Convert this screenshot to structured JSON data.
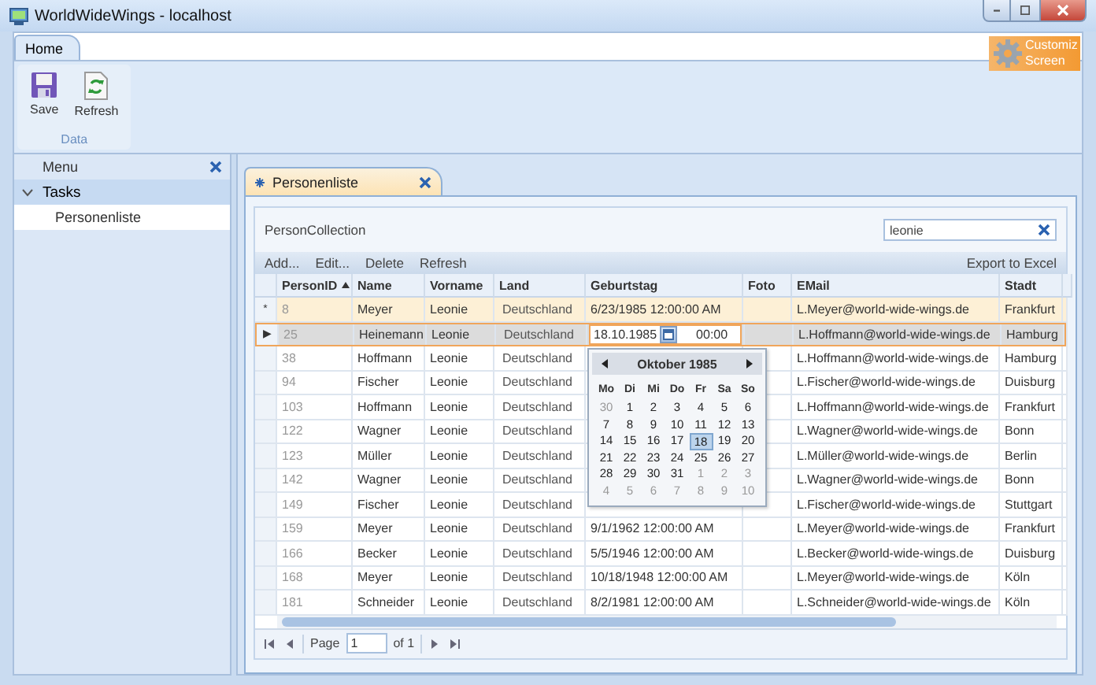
{
  "window": {
    "title": "WorldWideWings - localhost"
  },
  "ribbon": {
    "tabs": [
      {
        "label": "Home",
        "selected": true
      }
    ],
    "groups": [
      {
        "label": "Data",
        "buttons": [
          {
            "label": "Save",
            "kind": "save"
          },
          {
            "label": "Refresh",
            "kind": "refresh"
          }
        ]
      }
    ],
    "customize": {
      "label_lines": [
        "Customiz",
        "Screen"
      ]
    }
  },
  "menu": {
    "title": "Menu",
    "groups": [
      {
        "label": "Tasks",
        "expanded": true,
        "items": [
          {
            "label": "Personenliste",
            "selected": true
          }
        ]
      }
    ]
  },
  "documents": {
    "tabs": [
      {
        "label": "Personenliste",
        "selected": true
      }
    ]
  },
  "screen": {
    "collection_title": "PersonCollection",
    "search": {
      "value": "leonie"
    },
    "commands": [
      "Add...",
      "Edit...",
      "Delete",
      "Refresh"
    ],
    "export": "Export to Excel",
    "grid": {
      "columns": [
        {
          "label": "PersonID",
          "sort_ascending": true
        },
        {
          "label": "Name"
        },
        {
          "label": "Vorname"
        },
        {
          "label": "Land"
        },
        {
          "label": "Geburtstag"
        },
        {
          "label": "Foto"
        },
        {
          "label": "EMail"
        },
        {
          "label": "Stadt"
        }
      ],
      "rows": [
        {
          "indicator": "*",
          "highlighted": true,
          "selected": false,
          "id": "8",
          "name": "Meyer",
          "vorname": "Leonie",
          "land": "Deutschland",
          "geburtstag": "6/23/1985 12:00:00 AM",
          "email": "L.Meyer@world-wide-wings.de",
          "stadt": "Frankfurt"
        },
        {
          "indicator": "▶",
          "highlighted": false,
          "selected": true,
          "id": "25",
          "name": "Heinemann",
          "vorname": "Leonie",
          "land": "Deutschland",
          "email": "L.Hoffmann@world-wide-wings.de",
          "stadt": "Hamburg",
          "editor": {
            "date": "18.10.1985",
            "time": "00:00",
            "calendar": {
              "month": "Oktober 1985",
              "weekdays": [
                "Mo",
                "Di",
                "Mi",
                "Do",
                "Fr",
                "Sa",
                "So"
              ],
              "weeks": [
                [
                  {
                    "day": "30",
                    "outside": true,
                    "selected": false
                  },
                  {
                    "day": "1",
                    "outside": false,
                    "selected": false
                  },
                  {
                    "day": "2",
                    "outside": false,
                    "selected": false
                  },
                  {
                    "day": "3",
                    "outside": false,
                    "selected": false
                  },
                  {
                    "day": "4",
                    "outside": false,
                    "selected": false
                  },
                  {
                    "day": "5",
                    "outside": false,
                    "selected": false
                  },
                  {
                    "day": "6",
                    "outside": false,
                    "selected": false
                  }
                ],
                [
                  {
                    "day": "7",
                    "outside": false,
                    "selected": false
                  },
                  {
                    "day": "8",
                    "outside": false,
                    "selected": false
                  },
                  {
                    "day": "9",
                    "outside": false,
                    "selected": false
                  },
                  {
                    "day": "10",
                    "outside": false,
                    "selected": false
                  },
                  {
                    "day": "11",
                    "outside": false,
                    "selected": false
                  },
                  {
                    "day": "12",
                    "outside": false,
                    "selected": false
                  },
                  {
                    "day": "13",
                    "outside": false,
                    "selected": false
                  }
                ],
                [
                  {
                    "day": "14",
                    "outside": false,
                    "selected": false
                  },
                  {
                    "day": "15",
                    "outside": false,
                    "selected": false
                  },
                  {
                    "day": "16",
                    "outside": false,
                    "selected": false
                  },
                  {
                    "day": "17",
                    "outside": false,
                    "selected": false
                  },
                  {
                    "day": "18",
                    "outside": false,
                    "selected": true
                  },
                  {
                    "day": "19",
                    "outside": false,
                    "selected": false
                  },
                  {
                    "day": "20",
                    "outside": false,
                    "selected": false
                  }
                ],
                [
                  {
                    "day": "21",
                    "outside": false,
                    "selected": false
                  },
                  {
                    "day": "22",
                    "outside": false,
                    "selected": false
                  },
                  {
                    "day": "23",
                    "outside": false,
                    "selected": false
                  },
                  {
                    "day": "24",
                    "outside": false,
                    "selected": false
                  },
                  {
                    "day": "25",
                    "outside": false,
                    "selected": false
                  },
                  {
                    "day": "26",
                    "outside": false,
                    "selected": false
                  },
                  {
                    "day": "27",
                    "outside": false,
                    "selected": false
                  }
                ],
                [
                  {
                    "day": "28",
                    "outside": false,
                    "selected": false
                  },
                  {
                    "day": "29",
                    "outside": false,
                    "selected": false
                  },
                  {
                    "day": "30",
                    "outside": false,
                    "selected": false
                  },
                  {
                    "day": "31",
                    "outside": false,
                    "selected": false
                  },
                  {
                    "day": "1",
                    "outside": true,
                    "selected": false
                  },
                  {
                    "day": "2",
                    "outside": true,
                    "selected": false
                  },
                  {
                    "day": "3",
                    "outside": true,
                    "selected": false
                  }
                ],
                [
                  {
                    "day": "4",
                    "outside": true,
                    "selected": false
                  },
                  {
                    "day": "5",
                    "outside": true,
                    "selected": false
                  },
                  {
                    "day": "6",
                    "outside": true,
                    "selected": false
                  },
                  {
                    "day": "7",
                    "outside": true,
                    "selected": false
                  },
                  {
                    "day": "8",
                    "outside": true,
                    "selected": false
                  },
                  {
                    "day": "9",
                    "outside": true,
                    "selected": false
                  },
                  {
                    "day": "10",
                    "outside": true,
                    "selected": false
                  }
                ]
              ]
            }
          }
        },
        {
          "highlighted": false,
          "selected": false,
          "id": "38",
          "name": "Hoffmann",
          "vorname": "Leonie",
          "land": "Deutschland",
          "email": "L.Hoffmann@world-wide-wings.de",
          "stadt": "Hamburg"
        },
        {
          "highlighted": false,
          "selected": false,
          "id": "94",
          "name": "Fischer",
          "vorname": "Leonie",
          "land": "Deutschland",
          "email": "L.Fischer@world-wide-wings.de",
          "stadt": "Duisburg"
        },
        {
          "highlighted": false,
          "selected": false,
          "id": "103",
          "name": "Hoffmann",
          "vorname": "Leonie",
          "land": "Deutschland",
          "email": "L.Hoffmann@world-wide-wings.de",
          "stadt": "Frankfurt"
        },
        {
          "highlighted": false,
          "selected": false,
          "id": "122",
          "name": "Wagner",
          "vorname": "Leonie",
          "land": "Deutschland",
          "email": "L.Wagner@world-wide-wings.de",
          "stadt": "Bonn"
        },
        {
          "highlighted": false,
          "selected": false,
          "id": "123",
          "name": "Müller",
          "vorname": "Leonie",
          "land": "Deutschland",
          "email": "L.Müller@world-wide-wings.de",
          "stadt": "Berlin"
        },
        {
          "highlighted": false,
          "selected": false,
          "id": "142",
          "name": "Wagner",
          "vorname": "Leonie",
          "land": "Deutschland",
          "email": "L.Wagner@world-wide-wings.de",
          "stadt": "Bonn"
        },
        {
          "highlighted": false,
          "selected": false,
          "id": "149",
          "name": "Fischer",
          "vorname": "Leonie",
          "land": "Deutschland",
          "email": "L.Fischer@world-wide-wings.de",
          "stadt": "Stuttgart"
        },
        {
          "highlighted": false,
          "selected": false,
          "id": "159",
          "name": "Meyer",
          "vorname": "Leonie",
          "land": "Deutschland",
          "geburtstag": "9/1/1962 12:00:00 AM",
          "email": "L.Meyer@world-wide-wings.de",
          "stadt": "Frankfurt"
        },
        {
          "highlighted": false,
          "selected": false,
          "id": "166",
          "name": "Becker",
          "vorname": "Leonie",
          "land": "Deutschland",
          "geburtstag": "5/5/1946 12:00:00 AM",
          "email": "L.Becker@world-wide-wings.de",
          "stadt": "Duisburg"
        },
        {
          "highlighted": false,
          "selected": false,
          "id": "168",
          "name": "Meyer",
          "vorname": "Leonie",
          "land": "Deutschland",
          "geburtstag": "10/18/1948 12:00:00 AM",
          "email": "L.Meyer@world-wide-wings.de",
          "stadt": "Köln"
        },
        {
          "highlighted": false,
          "selected": false,
          "id": "181",
          "name": "Schneider",
          "vorname": "Leonie",
          "land": "Deutschland",
          "geburtstag": "8/2/1981 12:00:00 AM",
          "email": "L.Schneider@world-wide-wings.de",
          "stadt": "Köln"
        }
      ]
    },
    "pager": {
      "page_label": "Page",
      "page": "1",
      "of": "of 1"
    }
  }
}
